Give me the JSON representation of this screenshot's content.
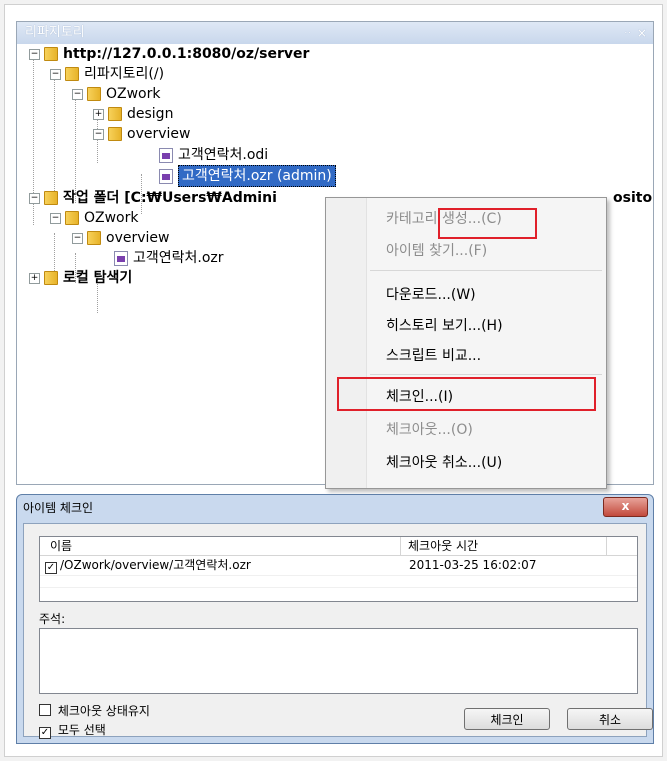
{
  "repository": {
    "title": "리파지토리",
    "controls": "ᆢ ×",
    "server": "http://127.0.0.1:8080/oz/server",
    "repo_root": "리파지토리(/)",
    "ozwork": "OZwork",
    "design": "design",
    "overview": "overview",
    "file_odi": "고객연락처.odi",
    "file_ozr_selected": "고객연락처.ozr (admin)",
    "work_folder": "작업 폴더 [C:₩Users₩Admini",
    "work_folder_suffix": "ository",
    "work_ozwork": "OZwork",
    "work_overview": "overview",
    "work_file": "고객연락처.ozr",
    "local_explorer": "로컬 탐색기"
  },
  "context_menu": {
    "items": [
      {
        "label": "카테고리 생성...(C)",
        "disabled": true
      },
      {
        "label": "아이템 찾기...(F)",
        "disabled": true
      },
      {
        "label": "다운로드...(W)",
        "disabled": false
      },
      {
        "label": "히스토리 보기...(H)",
        "disabled": false
      },
      {
        "label": "스크립트 비교...",
        "disabled": false
      },
      {
        "label": "체크인...(I)",
        "disabled": false
      },
      {
        "label": "체크아웃...(O)",
        "disabled": true
      },
      {
        "label": "체크아웃 취소...(U)",
        "disabled": false
      }
    ]
  },
  "dialog": {
    "title": "아이템 체크인",
    "close": "x",
    "col_name": "이름",
    "col_time": "체크아웃 시간",
    "row_name": "/OZwork/overview/고객연락처.ozr",
    "row_time": "2011-03-25 16:02:07",
    "row_check": "✓",
    "comment_label": "주석:",
    "keep_checkout": "체크아웃 상태유지",
    "select_all": "모두 선택",
    "select_all_check": "✓",
    "checkin_button": "체크인",
    "cancel_button": "취소"
  }
}
